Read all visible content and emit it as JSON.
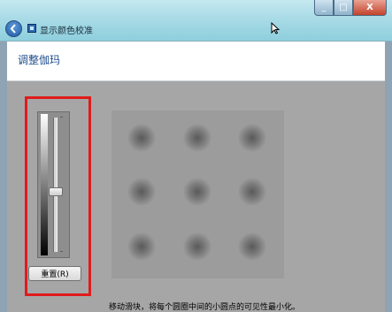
{
  "window": {
    "title": "显示颜色校准",
    "min_symbol": "_",
    "max_symbol": "□",
    "close_symbol": "X"
  },
  "header": {
    "title": "调整伽玛"
  },
  "slider": {
    "level_fraction": 0.55
  },
  "reset_button": {
    "label": "重置(R)"
  },
  "instructions": "移动滑块，将每个圆圈中间的小圆点的可见性最小化。",
  "icons": [
    "back-arrow-icon",
    "app-icon",
    "mouse-cursor-icon"
  ],
  "colors": {
    "highlight_box": "#e01b1b",
    "header_title": "#1f4e8c"
  }
}
